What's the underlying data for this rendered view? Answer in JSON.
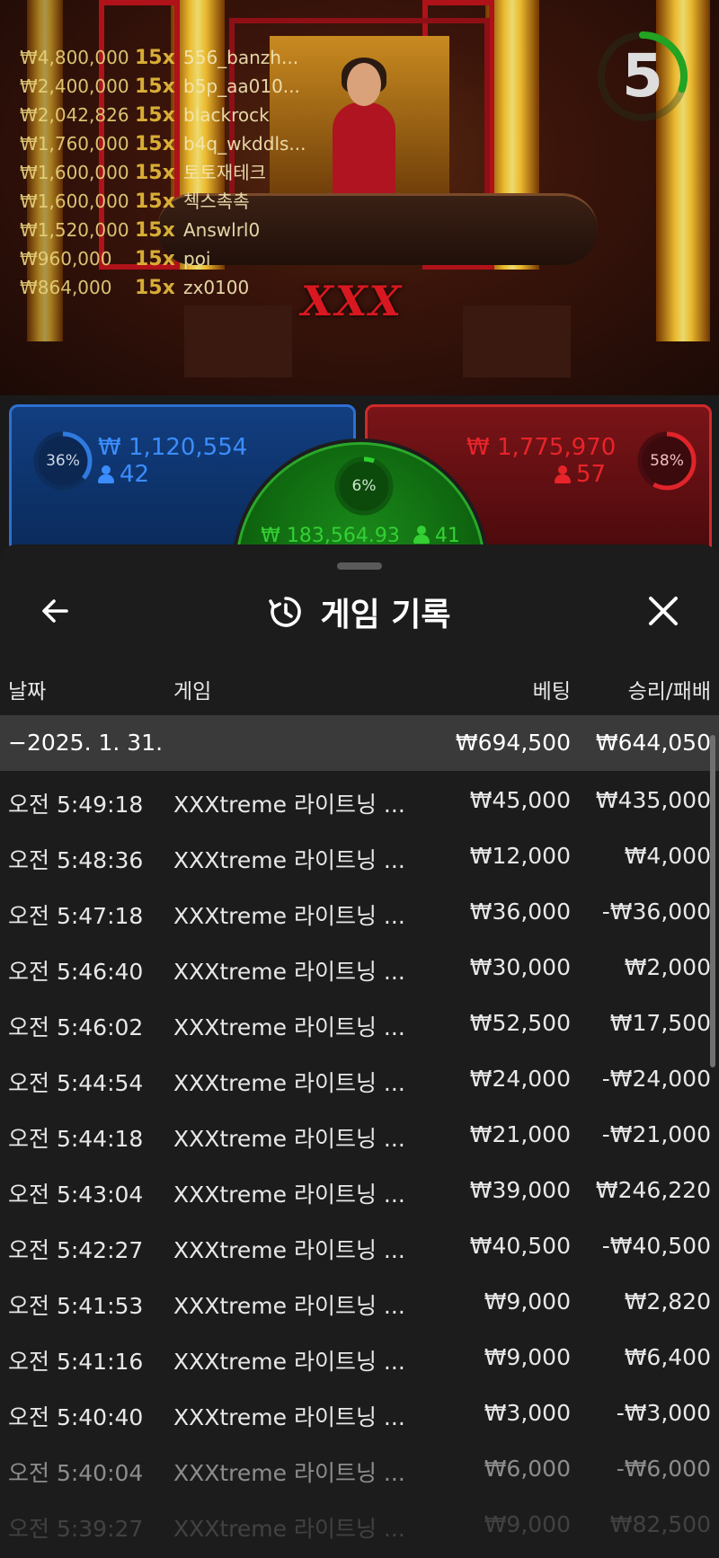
{
  "timer": {
    "value": "5",
    "progress": 0.3
  },
  "leaderboard": [
    {
      "amount": "₩4,800,000",
      "mult": "15x",
      "user": "556_banzh..."
    },
    {
      "amount": "₩2,400,000",
      "mult": "15x",
      "user": "b5p_aa010..."
    },
    {
      "amount": "₩2,042,826",
      "mult": "15x",
      "user": "blackrock"
    },
    {
      "amount": "₩1,760,000",
      "mult": "15x",
      "user": "b4q_wkddls..."
    },
    {
      "amount": "₩1,600,000",
      "mult": "15x",
      "user": "토토재테크"
    },
    {
      "amount": "₩1,600,000",
      "mult": "15x",
      "user": "첵스촉촉"
    },
    {
      "amount": "₩1,520,000",
      "mult": "15x",
      "user": "Answlrl0"
    },
    {
      "amount": "₩960,000",
      "mult": "15x",
      "user": "poi"
    },
    {
      "amount": "₩864,000",
      "mult": "15x",
      "user": "zx0100"
    }
  ],
  "table_logo": "XXX",
  "bets": {
    "player": {
      "pct_label": "36%",
      "pct": 0.36,
      "amount": "₩ 1,120,554",
      "count": "42",
      "color": "#3b8dff"
    },
    "banker": {
      "pct_label": "58%",
      "pct": 0.58,
      "amount": "₩ 1,775,970",
      "count": "57",
      "color": "#e8242a"
    },
    "tie": {
      "pct_label": "6%",
      "pct": 0.06,
      "amount": "₩ 183,564.93",
      "count": "41",
      "color": "#34d034"
    }
  },
  "sheet": {
    "title": "게임 기록",
    "columns": {
      "date": "날짜",
      "game": "게임",
      "bet": "베팅",
      "result": "승리/패배"
    },
    "group": {
      "date": "−2025. 1. 31.",
      "bet": "₩694,500",
      "result": "₩644,050"
    },
    "rows": [
      {
        "time": "오전 5:49:18",
        "game": "XXXtreme 라이트닝 ...",
        "bet": "₩45,000",
        "result": "₩435,000"
      },
      {
        "time": "오전 5:48:36",
        "game": "XXXtreme 라이트닝 ...",
        "bet": "₩12,000",
        "result": "₩4,000"
      },
      {
        "time": "오전 5:47:18",
        "game": "XXXtreme 라이트닝 ...",
        "bet": "₩36,000",
        "result": "-₩36,000"
      },
      {
        "time": "오전 5:46:40",
        "game": "XXXtreme 라이트닝 ...",
        "bet": "₩30,000",
        "result": "₩2,000"
      },
      {
        "time": "오전 5:46:02",
        "game": "XXXtreme 라이트닝 ...",
        "bet": "₩52,500",
        "result": "₩17,500"
      },
      {
        "time": "오전 5:44:54",
        "game": "XXXtreme 라이트닝 ...",
        "bet": "₩24,000",
        "result": "-₩24,000"
      },
      {
        "time": "오전 5:44:18",
        "game": "XXXtreme 라이트닝 ...",
        "bet": "₩21,000",
        "result": "-₩21,000"
      },
      {
        "time": "오전 5:43:04",
        "game": "XXXtreme 라이트닝 ...",
        "bet": "₩39,000",
        "result": "₩246,220"
      },
      {
        "time": "오전 5:42:27",
        "game": "XXXtreme 라이트닝 ...",
        "bet": "₩40,500",
        "result": "-₩40,500"
      },
      {
        "time": "오전 5:41:53",
        "game": "XXXtreme 라이트닝 ...",
        "bet": "₩9,000",
        "result": "₩2,820"
      },
      {
        "time": "오전 5:41:16",
        "game": "XXXtreme 라이트닝 ...",
        "bet": "₩9,000",
        "result": "₩6,400"
      },
      {
        "time": "오전 5:40:40",
        "game": "XXXtreme 라이트닝 ...",
        "bet": "₩3,000",
        "result": "-₩3,000"
      },
      {
        "time": "오전 5:40:04",
        "game": "XXXtreme 라이트닝 ...",
        "bet": "₩6,000",
        "result": "-₩6,000"
      },
      {
        "time": "오전 5:39:27",
        "game": "XXXtreme 라이트닝 ...",
        "bet": "₩9,000",
        "result": "₩82,500"
      }
    ]
  },
  "icons": {
    "back": "arrow-left-icon",
    "history": "history-icon",
    "close": "close-icon",
    "person": "person-icon"
  }
}
